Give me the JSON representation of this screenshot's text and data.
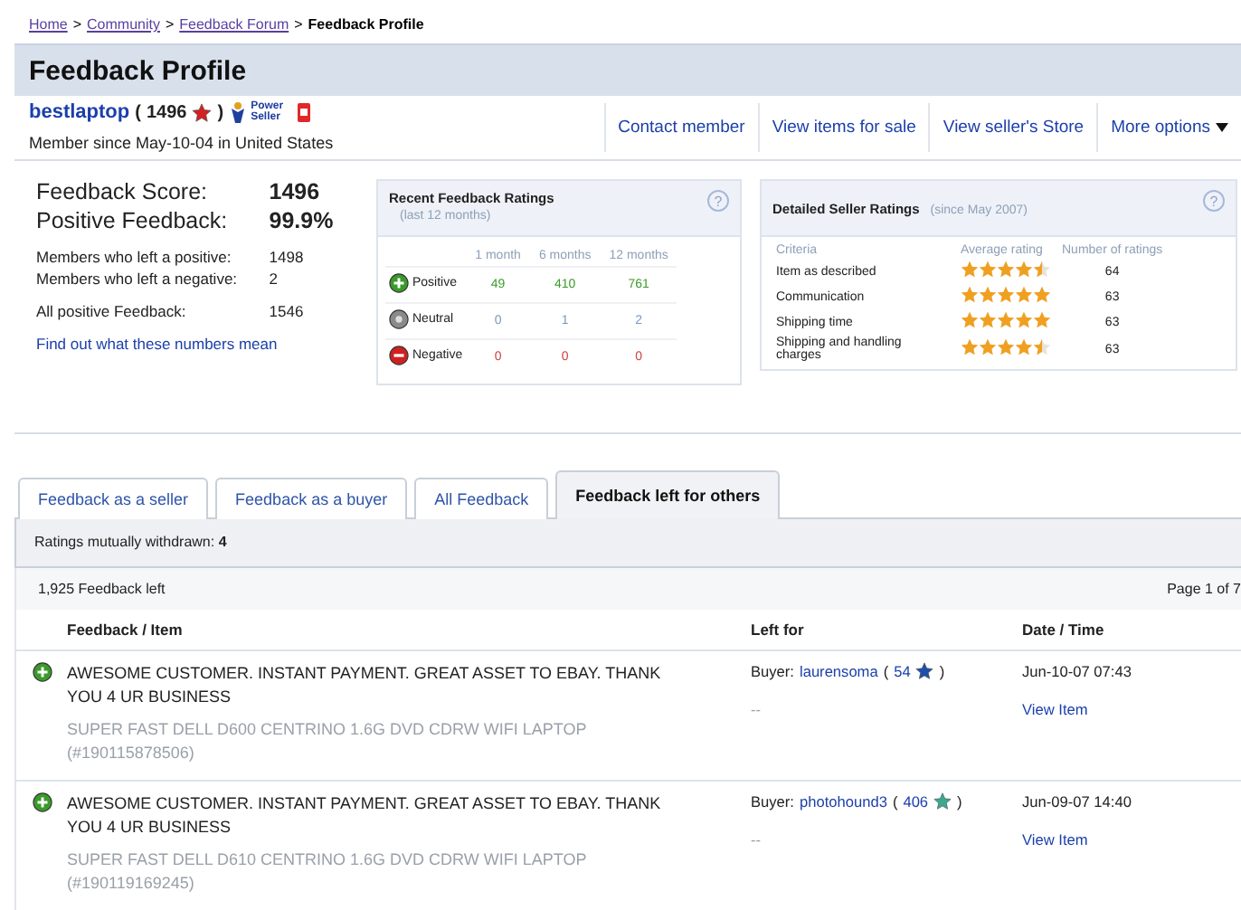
{
  "breadcrumb": [
    {
      "label": "Home",
      "link": true
    },
    {
      "label": "Community",
      "link": true
    },
    {
      "label": "Feedback Forum",
      "link": true
    },
    {
      "label": "Feedback Profile",
      "link": false
    }
  ],
  "separator": ">",
  "title": "Feedback Profile",
  "member": {
    "name": "bestlaptop",
    "open": "(",
    "score": "1496",
    "close": ")",
    "color": "#d42020",
    "since": "Member since May-10-04 in United States",
    "power_seller": "Power Seller"
  },
  "actions": [
    {
      "label": "Contact member"
    },
    {
      "label": "View items for sale"
    },
    {
      "label": "View seller's Store"
    },
    {
      "label": "More options",
      "caret": true
    }
  ],
  "summary": {
    "score_label": "Feedback Score:",
    "score": "1496",
    "positive_label": "Positive Feedback:",
    "positive": "99.9%",
    "counts": [
      {
        "label": "Members who left a positive:",
        "value": "1498"
      },
      {
        "label": "Members who left a negative:",
        "value": "2"
      }
    ],
    "all_label": "All positive Feedback:",
    "all_value": "1546",
    "link": "Find out what these numbers mean"
  },
  "recent": {
    "title": "Recent Feedback Ratings",
    "subtitle": "(last 12 months)",
    "help": "?",
    "periods": [
      "1 month",
      "6 months",
      "12 months"
    ],
    "rows": [
      {
        "kind": "positive",
        "label": "Positive",
        "values": [
          "49",
          "410",
          "761"
        ]
      },
      {
        "kind": "neutral",
        "label": "Neutral",
        "values": [
          "0",
          "1",
          "2"
        ]
      },
      {
        "kind": "negative",
        "label": "Negative",
        "values": [
          "0",
          "0",
          "0"
        ]
      }
    ]
  },
  "detailed": {
    "title": "Detailed Seller Ratings",
    "subtitle": "(since May 2007)",
    "help": "?",
    "columns": [
      "Criteria",
      "Average rating",
      "Number of ratings"
    ],
    "rows": [
      {
        "criteria": "Item as described",
        "stars": 4.5,
        "count": "64"
      },
      {
        "criteria": "Communication",
        "stars": 5,
        "count": "63"
      },
      {
        "criteria": "Shipping time",
        "stars": 5,
        "count": "63"
      },
      {
        "criteria": "Shipping and handling charges",
        "stars": 4.5,
        "count": "63"
      }
    ]
  },
  "tabs": [
    {
      "label": "Feedback as a seller",
      "selected": false
    },
    {
      "label": "Feedback as a buyer",
      "selected": false
    },
    {
      "label": "All Feedback",
      "selected": false
    },
    {
      "label": "Feedback left for others",
      "selected": true
    }
  ],
  "withdrawn": {
    "label": "Ratings mutually withdrawn:",
    "value": "4"
  },
  "feedback_count": "1,925 Feedback left",
  "page": "Page 1 of 7",
  "columns": [
    "Feedback / Item",
    "Left for",
    "Date / Time"
  ],
  "entries": [
    {
      "kind": "positive",
      "comment": "AWESOME CUSTOMER. INSTANT PAYMENT. GREAT ASSET TO EBAY. THANK YOU 4 UR BUSINESS",
      "item": "SUPER FAST DELL D600 CENTRINO 1.6G DVD CDRW WIFI LAPTOP (#190115878506)",
      "role": "Buyer:",
      "user": "laurensoma",
      "open": "(",
      "user_score": "54",
      "close": ")",
      "color": "#1f4fa8",
      "price": "--",
      "date": "Jun-10-07 07:43",
      "view": "View Item"
    },
    {
      "kind": "positive",
      "comment": "AWESOME CUSTOMER. INSTANT PAYMENT. GREAT ASSET TO EBAY. THANK YOU 4 UR BUSINESS",
      "item": "SUPER FAST DELL D610 CENTRINO 1.6G DVD CDRW WIFI LAPTOP (#190119169245)",
      "role": "Buyer:",
      "user": "photohound3",
      "open": "(",
      "user_score": "406",
      "close": ")",
      "color": "#3aa890",
      "price": "--",
      "date": "Jun-09-07 14:40",
      "view": "View Item"
    }
  ]
}
